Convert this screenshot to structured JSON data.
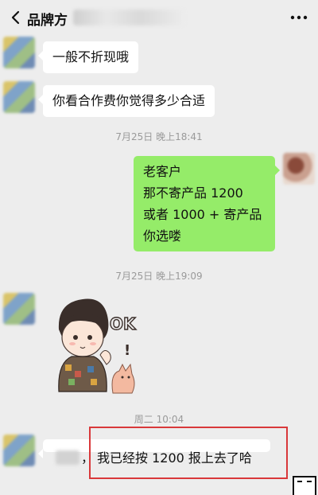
{
  "header": {
    "title": "品牌方",
    "back_icon": "chevron-left-icon",
    "more_icon": "ellipsis-icon"
  },
  "messages": [
    {
      "from": "other",
      "text": "一般不折现哦"
    },
    {
      "from": "other",
      "text": "你看合作费你觉得多少合适"
    },
    {
      "timestamp": "7月25日 晚上18:41"
    },
    {
      "from": "me",
      "lines": [
        "老客户",
        "那不寄产品 1200",
        "或者 1000 + 寄产品",
        "你选喽"
      ]
    },
    {
      "timestamp": "7月25日 晚上19:09"
    },
    {
      "from": "other",
      "sticker": "ok-boy-sticker",
      "sticker_text": "OK"
    },
    {
      "timestamp": "周二 10:04"
    },
    {
      "from": "other",
      "text": "我已经按 1200 报上去了哈",
      "prefix": "，"
    }
  ],
  "colors": {
    "background": "#ededed",
    "bubble_other": "#ffffff",
    "bubble_me": "#95ec69",
    "timestamp": "#9a9a9a",
    "highlight_border": "#d9383a"
  }
}
